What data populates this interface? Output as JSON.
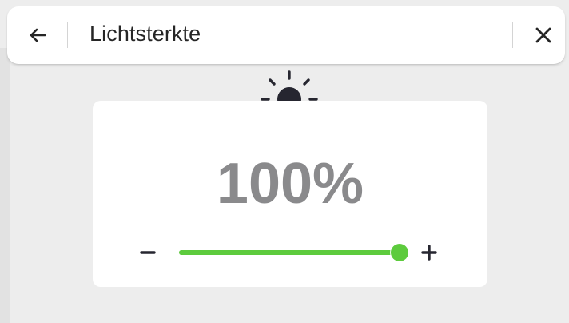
{
  "header": {
    "title": "Lichtsterkte",
    "back_icon": "arrow-left-icon",
    "close_icon": "close-icon"
  },
  "brightness": {
    "icon": "sun-icon",
    "value_label": "100%",
    "level_percent": 100,
    "decrease_icon": "minus-icon",
    "increase_icon": "plus-icon"
  },
  "colors": {
    "accent": "#5dcb3d",
    "value_text": "#8a8a8c",
    "icon": "#262630"
  }
}
